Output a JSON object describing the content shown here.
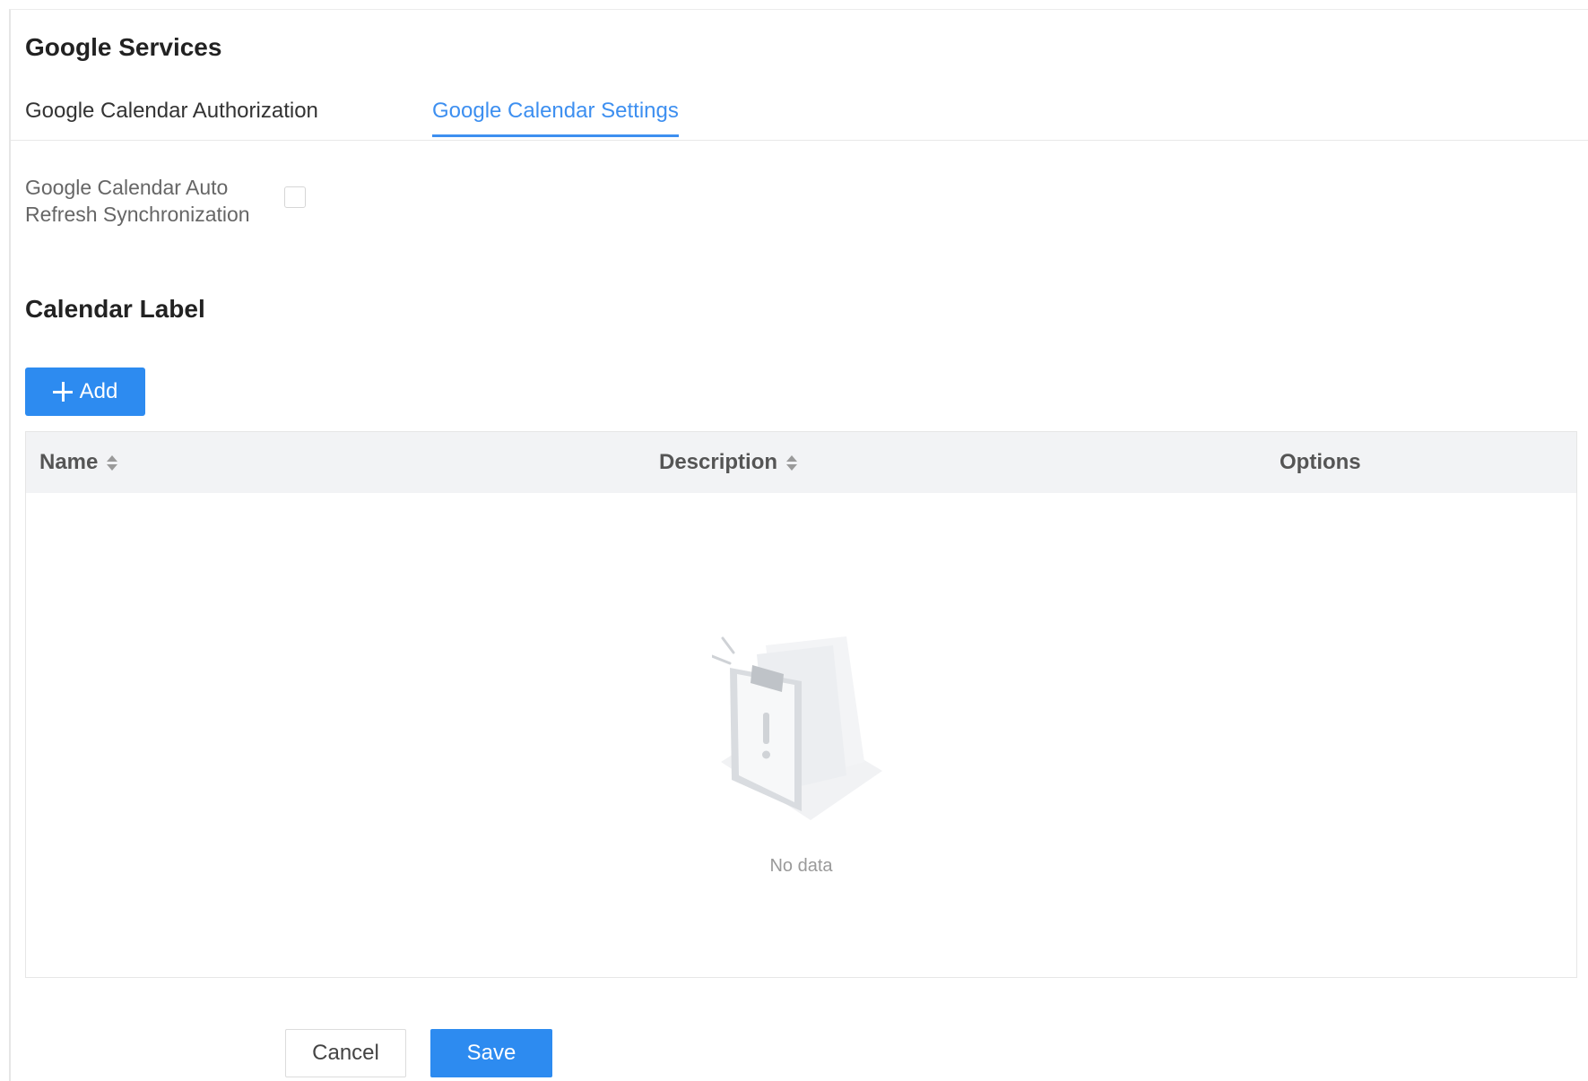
{
  "page": {
    "title": "Google Services"
  },
  "tabs": [
    {
      "label": "Google Calendar Authorization",
      "active": false
    },
    {
      "label": "Google Calendar Settings",
      "active": true
    }
  ],
  "settings": {
    "auto_refresh_label": "Google Calendar Auto Refresh Synchronization",
    "auto_refresh_checked": false
  },
  "calendar_label": {
    "section_title": "Calendar Label",
    "add_button_label": "Add",
    "table": {
      "columns": [
        {
          "label": "Name",
          "sortable": true
        },
        {
          "label": "Description",
          "sortable": true
        },
        {
          "label": "Options",
          "sortable": false
        }
      ],
      "rows": [],
      "empty_text": "No data"
    }
  },
  "footer": {
    "cancel_label": "Cancel",
    "save_label": "Save"
  },
  "colors": {
    "accent": "#2d8bf0",
    "active_tab": "#3d8ff0",
    "table_header_bg": "#f2f3f5"
  },
  "icons": {
    "add": "plus-icon",
    "sort": "sort-icon",
    "empty": "empty-clipboard-icon"
  }
}
